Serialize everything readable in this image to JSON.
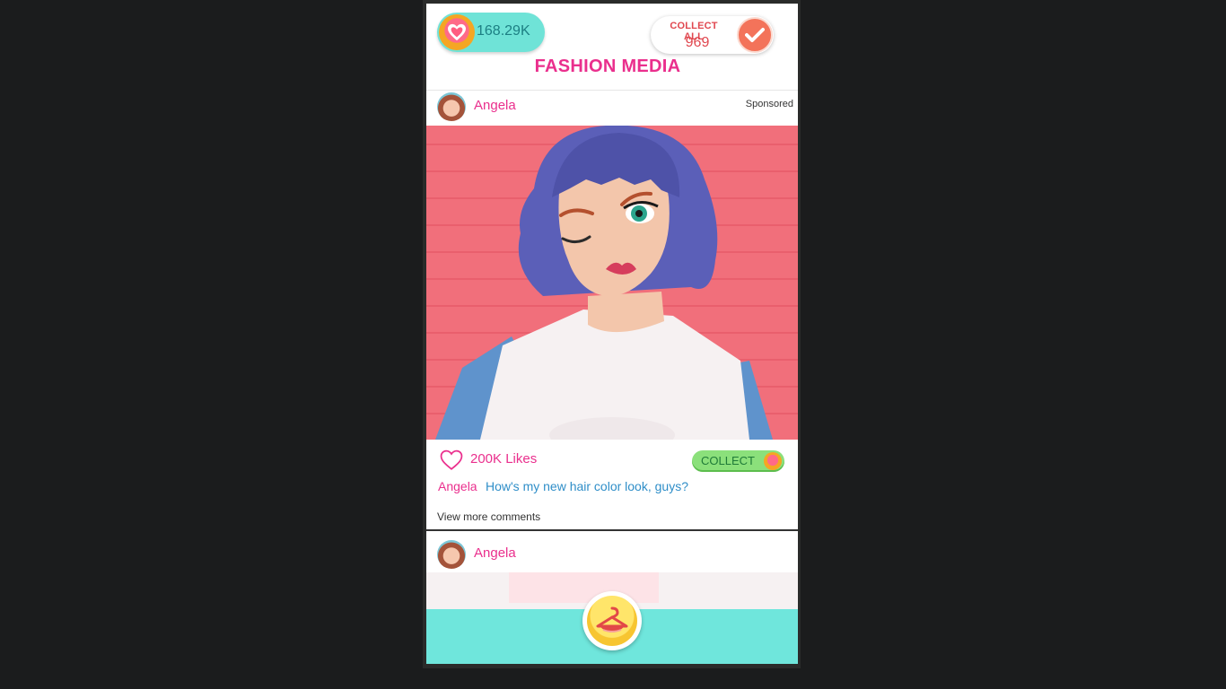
{
  "header": {
    "hearts_value": "168.29K",
    "collect_all_label": "COLLECT ALL",
    "collect_all_count": "969",
    "title": "FASHION MEDIA"
  },
  "post": {
    "author": "Angela",
    "sponsored": "Sponsored",
    "likes": "200K Likes",
    "collect_label": "COLLECT",
    "comment_author": "Angela",
    "comment_text": "How's my new hair color look, guys?",
    "view_more": "View more comments"
  },
  "next_post": {
    "author": "Angela"
  },
  "colors": {
    "accent_pink": "#ea2f8d",
    "teal": "#6fe6dc",
    "collect_green": "#8be07b",
    "comment_blue": "#2f8ec8"
  },
  "icons": [
    "heart-coin-icon",
    "checkmark-icon",
    "heart-outline-icon",
    "wardrobe-hanger-icon"
  ]
}
